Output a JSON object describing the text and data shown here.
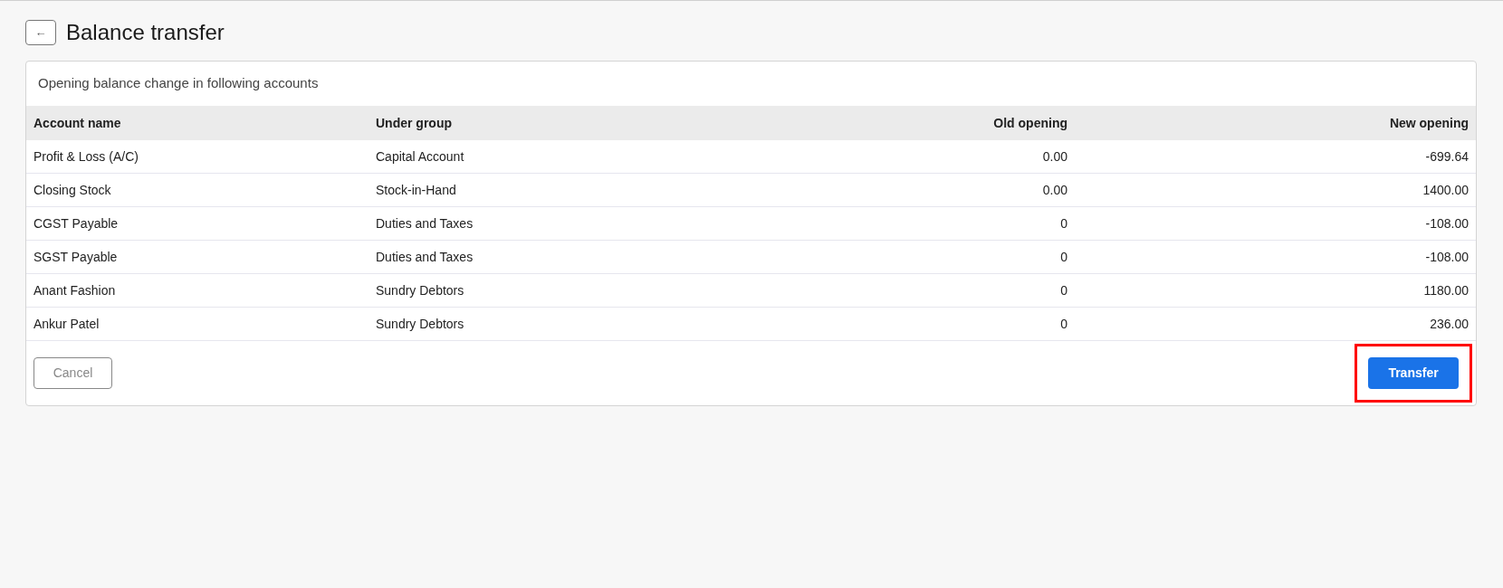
{
  "header": {
    "back": "←",
    "title": "Balance transfer"
  },
  "card": {
    "subtitle": "Opening balance change in following accounts",
    "columns": [
      "Account name",
      "Under group",
      "Old opening",
      "New opening"
    ],
    "rows": [
      [
        "Profit & Loss (A/C)",
        "Capital Account",
        "0.00",
        "-699.64"
      ],
      [
        "Closing Stock",
        "Stock-in-Hand",
        "0.00",
        "1400.00"
      ],
      [
        "CGST Payable",
        "Duties and Taxes",
        "0",
        "-108.00"
      ],
      [
        "SGST Payable",
        "Duties and Taxes",
        "0",
        "-108.00"
      ],
      [
        "Anant Fashion",
        "Sundry Debtors",
        "0",
        "1180.00"
      ],
      [
        "Ankur Patel",
        "Sundry Debtors",
        "0",
        "236.00"
      ]
    ],
    "cancel": "Cancel",
    "transfer": {
      "label": "Transfer",
      "highlighted": true
    }
  }
}
